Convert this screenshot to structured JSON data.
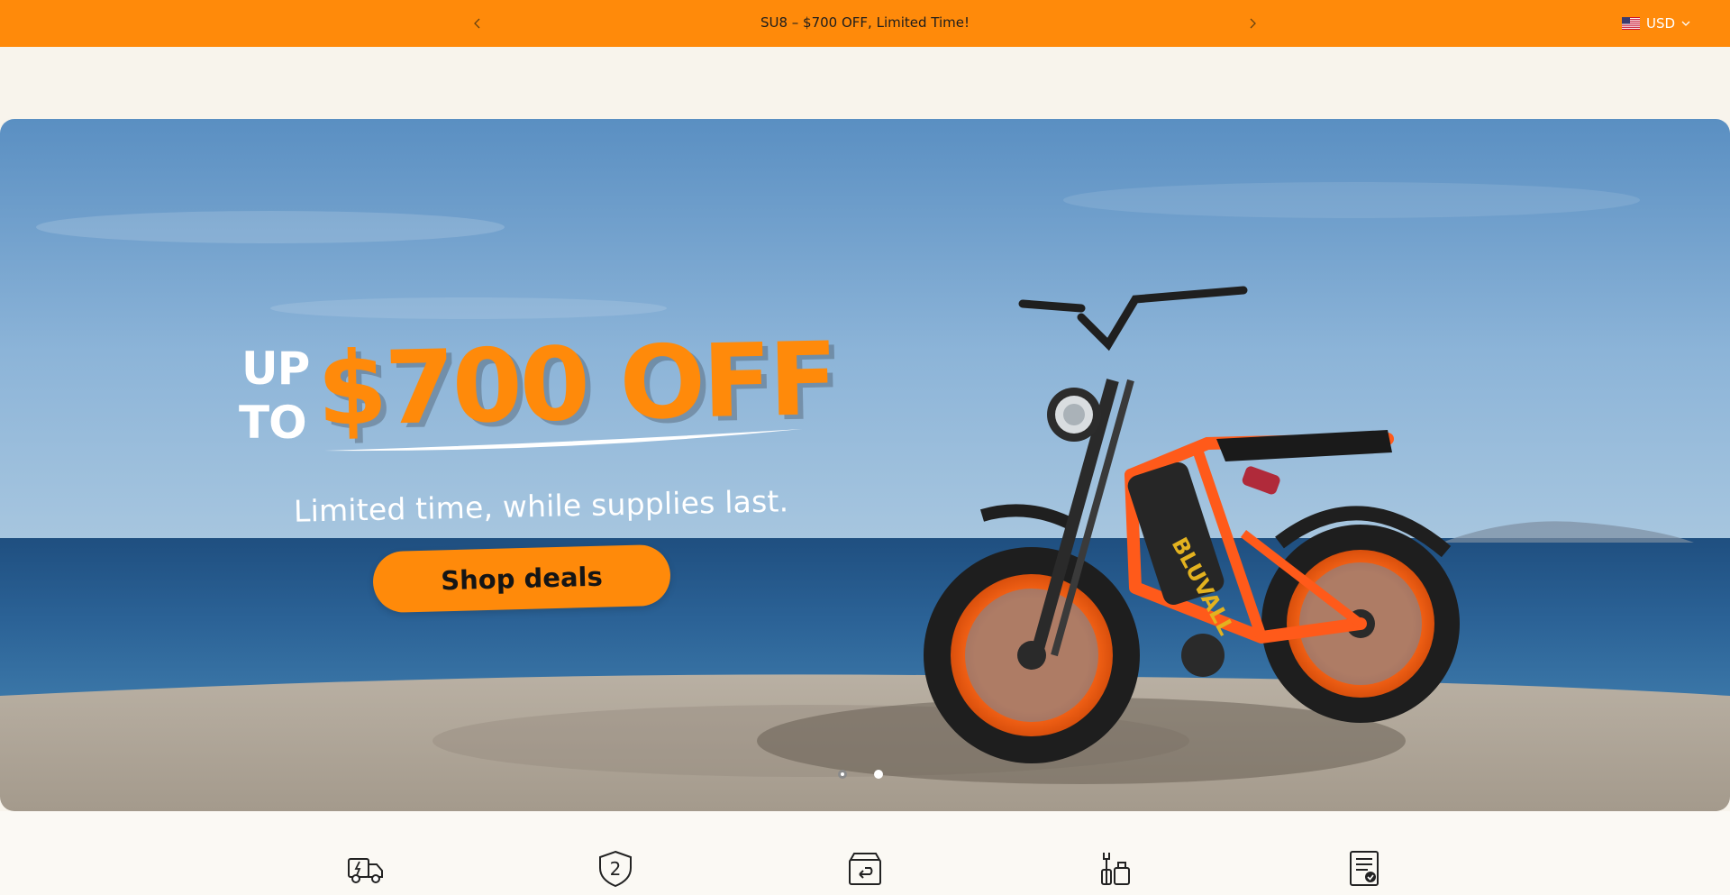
{
  "announcement": {
    "message": "SU8 – $700 OFF, Limited Time!",
    "prev_icon": "chevron-left-icon",
    "next_icon": "chevron-right-icon"
  },
  "currency": {
    "flag_icon": "us-flag-icon",
    "code": "USD",
    "dropdown_icon": "chevron-down-icon"
  },
  "hero": {
    "line_up": "UP",
    "line_to": "TO",
    "amount": "$700 OFF",
    "subtitle": "Limited time, while supplies last.",
    "cta_label": "Shop deals",
    "bike_brand": "BLUVALL",
    "slide_count": 2,
    "active_slide": 2
  },
  "features": [
    {
      "icon": "fast-delivery-truck-icon"
    },
    {
      "icon": "two-year-warranty-shield-icon"
    },
    {
      "icon": "return-box-icon"
    },
    {
      "icon": "service-tools-icon"
    },
    {
      "icon": "certificate-document-icon"
    }
  ],
  "colors": {
    "accent": "#ff8a0a",
    "page_bg": "#f8f4ec",
    "text_dark": "#1d1d1d"
  }
}
